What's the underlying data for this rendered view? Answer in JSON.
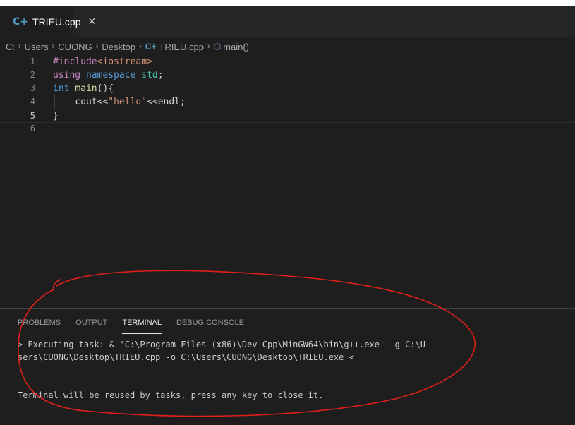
{
  "tab": {
    "icon": "cpp-file-icon",
    "icon_glyph": "C+",
    "label": "TRIEU.cpp",
    "close_glyph": "✕"
  },
  "breadcrumb": {
    "items": [
      "C:",
      "Users",
      "CUONG",
      "Desktop",
      "TRIEU.cpp",
      "main()"
    ],
    "separator": "›"
  },
  "editor": {
    "lines": [
      {
        "num": "1",
        "text_parts": [
          {
            "cls": "kw-ctrl",
            "t": "#include"
          },
          {
            "cls": "str-inc",
            "t": "<iostream>"
          }
        ]
      },
      {
        "num": "2",
        "text_parts": [
          {
            "cls": "kw-ctrl",
            "t": "using"
          },
          {
            "cls": "plain",
            "t": " "
          },
          {
            "cls": "kw",
            "t": "namespace"
          },
          {
            "cls": "plain",
            "t": " "
          },
          {
            "cls": "ns",
            "t": "std"
          },
          {
            "cls": "plain",
            "t": ";"
          }
        ]
      },
      {
        "num": "3",
        "text_parts": [
          {
            "cls": "kw",
            "t": "int"
          },
          {
            "cls": "plain",
            "t": " "
          },
          {
            "cls": "ident",
            "t": "main"
          },
          {
            "cls": "plain",
            "t": "(){"
          }
        ]
      },
      {
        "num": "4",
        "text_parts": [
          {
            "cls": "plain",
            "t": "    cout<<"
          },
          {
            "cls": "str-inc",
            "t": "\"hello\""
          },
          {
            "cls": "plain",
            "t": "<<endl;"
          }
        ]
      },
      {
        "num": "5",
        "text_parts": [
          {
            "cls": "plain",
            "t": "}"
          }
        ]
      },
      {
        "num": "6",
        "text_parts": []
      }
    ],
    "active_line": "5"
  },
  "panel": {
    "tabs": [
      "PROBLEMS",
      "OUTPUT",
      "TERMINAL",
      "DEBUG CONSOLE"
    ],
    "active_tab": "TERMINAL",
    "terminal_lines": [
      "> Executing task: & 'C:\\Program Files (x86)\\Dev-Cpp\\MinGW64\\bin\\g++.exe' -g C:\\U",
      "sers\\CUONG\\Desktop\\TRIEU.cpp -o C:\\Users\\CUONG\\Desktop\\TRIEU.exe <",
      "",
      "",
      "Terminal will be reused by tasks, press any key to close it."
    ]
  },
  "colors": {
    "annotation": "#e0201b",
    "cpp_icon": "#519aba",
    "symbol_icon": "#b180d7"
  }
}
